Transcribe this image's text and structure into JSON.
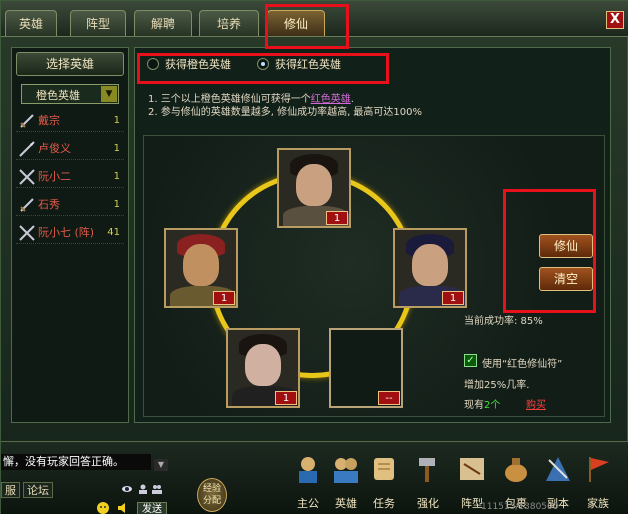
{
  "tabs": [
    {
      "label": "英雄",
      "active": false
    },
    {
      "label": "阵型",
      "active": false
    },
    {
      "label": "解聘",
      "active": false
    },
    {
      "label": "培养",
      "active": false
    },
    {
      "label": "修仙",
      "active": true
    }
  ],
  "close_label": "X",
  "left_panel": {
    "title": "选择英雄",
    "select_value": "橙色英雄",
    "heroes": [
      {
        "name": "戴宗",
        "count": "1"
      },
      {
        "name": "卢俊义",
        "count": "1"
      },
      {
        "name": "阮小二",
        "count": "1"
      },
      {
        "name": "石秀",
        "count": "1"
      },
      {
        "name": "阮小七 (阵)",
        "count": "41"
      }
    ]
  },
  "mode": {
    "options": [
      {
        "label": "获得橙色英雄",
        "selected": false
      },
      {
        "label": "获得红色英雄",
        "selected": true
      }
    ]
  },
  "rules": {
    "line1_prefix": "1. 三个以上橙色英雄修仙可获得一个",
    "line1_link": "红色英雄",
    "line1_suffix": ".",
    "line2": "2. 参与修仙的英雄数量越多, 修仙成功率越高, 最高可达100%"
  },
  "slots": [
    {
      "badge": "1",
      "empty": false
    },
    {
      "badge": "1",
      "empty": false
    },
    {
      "badge": "1",
      "empty": false
    },
    {
      "badge": "1",
      "empty": false
    },
    {
      "badge": "--",
      "empty": true
    }
  ],
  "buttons": {
    "cultivate": "修仙",
    "clear": "清空"
  },
  "rate": {
    "current": "当前成功率: 85%",
    "use_item": "使用“红色修仙符”",
    "bonus": "增加25%几率.",
    "owned_prefix": "现有",
    "owned_count": "2个",
    "buy": "购买"
  },
  "chat": {
    "message": "懈，没有玩家回答正确。",
    "tabs": [
      "服",
      "论坛"
    ],
    "send": "发送"
  },
  "exp_button": "经验\n分配",
  "bottom_nav": [
    {
      "label": "主公"
    },
    {
      "label": "英雄"
    },
    {
      "label": "任务"
    },
    {
      "label": "强化"
    },
    {
      "label": "阵型"
    },
    {
      "label": "包裹"
    },
    {
      "label": "副本"
    },
    {
      "label": "家族"
    }
  ],
  "ticker": "111515/1380500",
  "colors": {
    "highlight": "#e8101a",
    "gold_ring": "#e8c61a",
    "hero_name": "#e25a4a",
    "button": "#a0521e"
  }
}
